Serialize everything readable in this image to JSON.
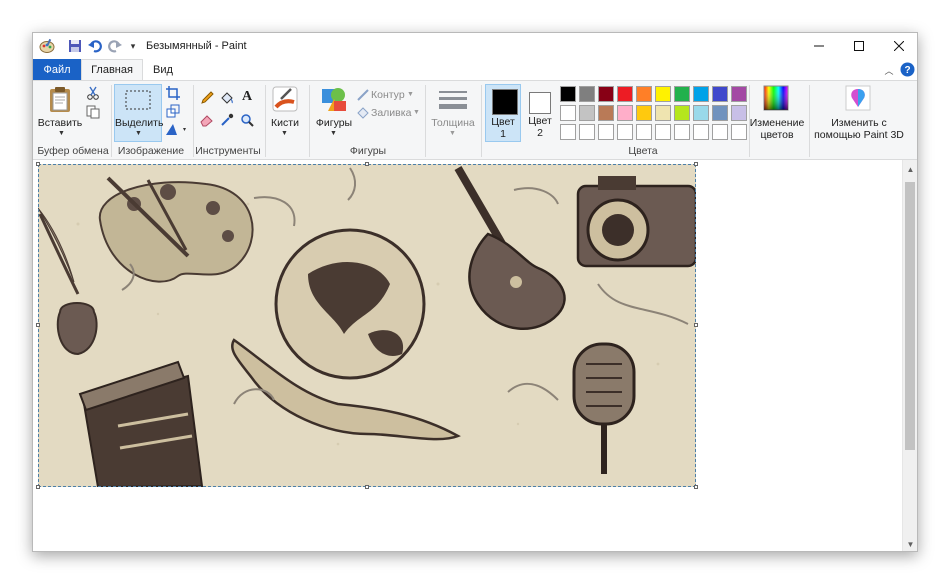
{
  "window": {
    "title": "Безымянный - Paint"
  },
  "quick_access": [
    "paint-app-icon",
    "save-icon",
    "undo-icon",
    "redo-icon",
    "customize-dropdown-icon"
  ],
  "tabs": {
    "file": "Файл",
    "home": "Главная",
    "view": "Вид"
  },
  "ribbon": {
    "clipboard": {
      "paste": "Вставить",
      "group": "Буфер обмена"
    },
    "image": {
      "select": "Выделить",
      "group": "Изображение"
    },
    "tools": {
      "group": "Инструменты"
    },
    "brushes": {
      "label": "Кисти"
    },
    "shapes": {
      "shapes": "Фигуры",
      "outline": "Контур",
      "fill": "Заливка",
      "group": "Фигуры"
    },
    "size": {
      "label": "Толщина"
    },
    "colors": {
      "color1_label": "Цвет 1",
      "color1_line1": "Цвет",
      "color1_line2": "1",
      "color2_line1": "Цвет",
      "color2_line2": "2",
      "color1_value": "#000000",
      "color2_value": "#ffffff",
      "edit_line1": "Изменение",
      "edit_line2": "цветов",
      "group": "Цвета",
      "palette_row1": [
        "#000000",
        "#7f7f7f",
        "#880015",
        "#ed1c24",
        "#ff7f27",
        "#fff200",
        "#22b14c",
        "#00a2e8",
        "#3f48cc",
        "#a349a4"
      ],
      "palette_row2": [
        "#ffffff",
        "#c3c3c3",
        "#b97a57",
        "#ffaec9",
        "#ffc90e",
        "#efe4b0",
        "#b5e61d",
        "#99d9ea",
        "#7092be",
        "#c8bfe7"
      ],
      "palette_row3": [
        "#ffffff",
        "#ffffff",
        "#ffffff",
        "#ffffff",
        "#ffffff",
        "#ffffff",
        "#ffffff",
        "#ffffff",
        "#ffffff",
        "#ffffff"
      ]
    },
    "paint3d": {
      "line1": "Изменить с",
      "line2": "помощью Paint 3D"
    }
  },
  "canvas": {
    "image": "sketch-illustration-palette-globe-guitar-camera-microphone-clapperboard"
  }
}
